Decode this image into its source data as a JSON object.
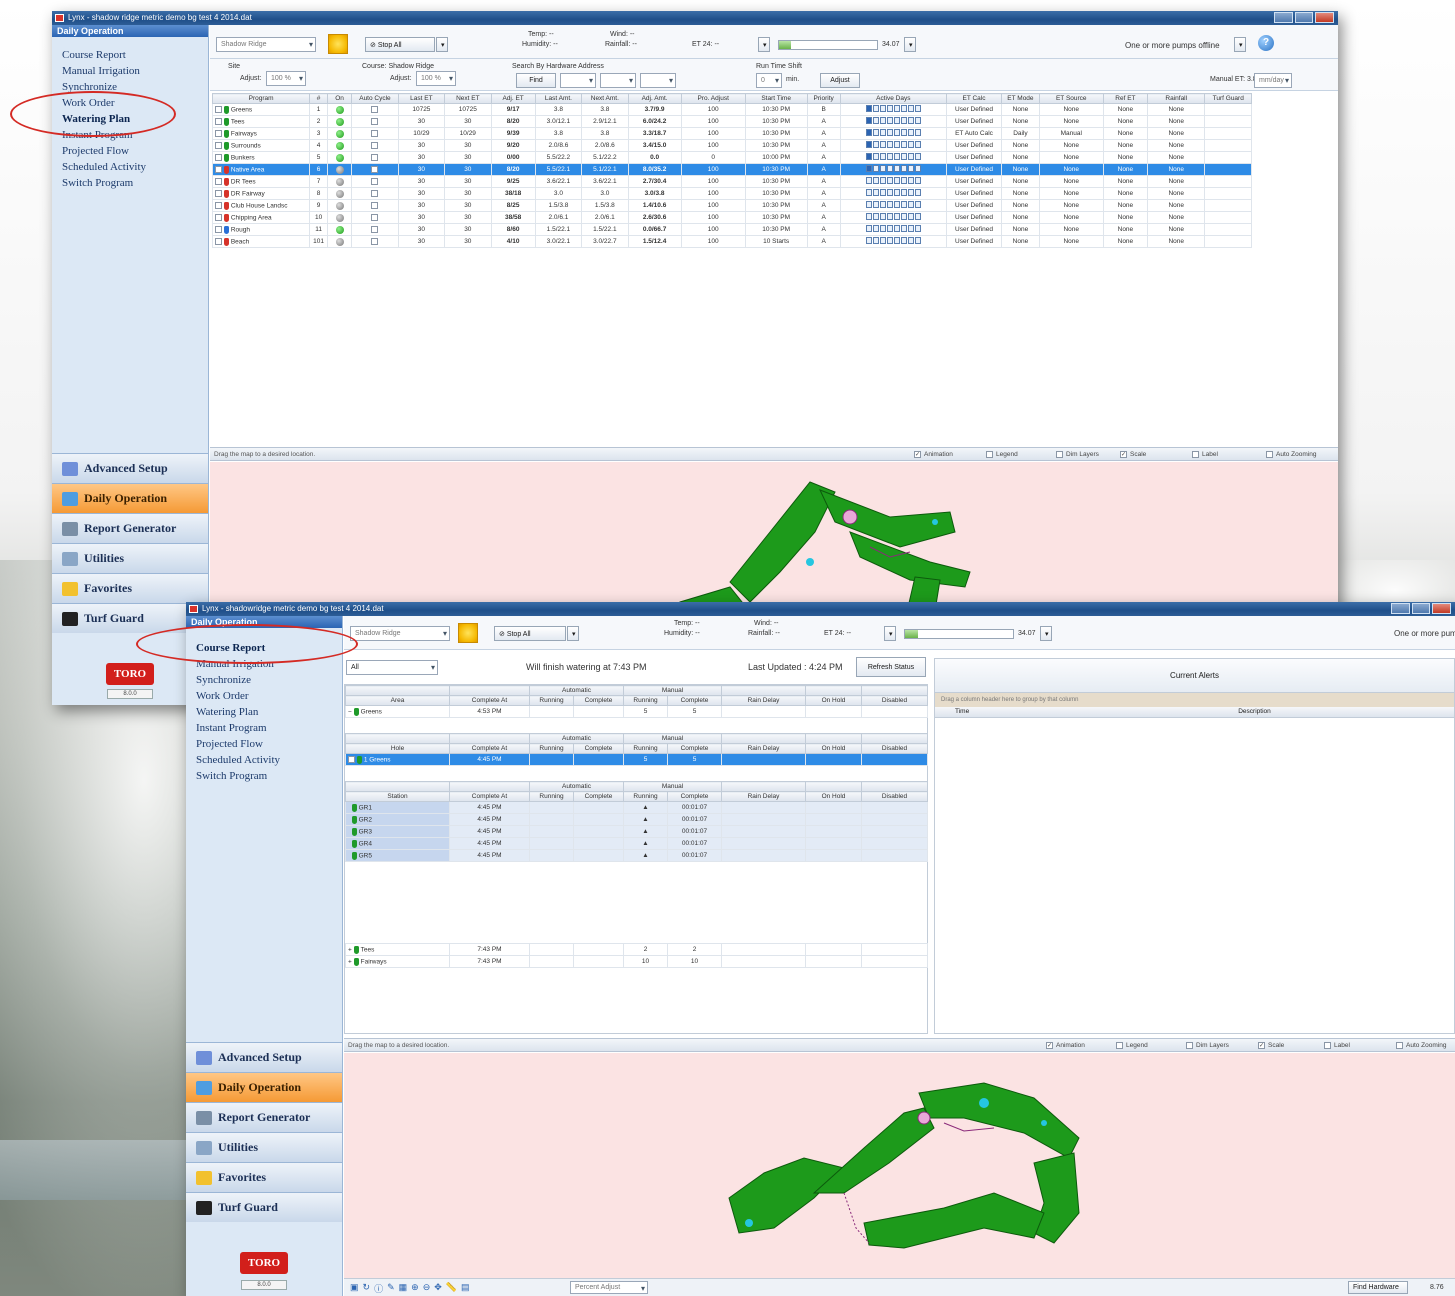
{
  "app": {
    "window1_title": "Lynx - shadow ridge metric demo bg test 4 2014.dat",
    "window2_title": "Lynx - shadowridge metric demo bg test 4 2014.dat",
    "brand": "TORO",
    "version": "8.0.0"
  },
  "nav": {
    "header": "Daily Operation",
    "items": [
      "Course Report",
      "Manual Irrigation",
      "Synchronize",
      "Work Order",
      "Watering Plan",
      "Instant Program",
      "Projected Flow",
      "Scheduled Activity",
      "Switch Program"
    ],
    "bottom": [
      "Advanced Setup",
      "Daily Operation",
      "Report Generator",
      "Utilities",
      "Favorites",
      "Turf Guard"
    ]
  },
  "weather": {
    "site": "Shadow Ridge",
    "temp": "Temp: --",
    "wind": "Wind: --",
    "humidity": "Humidity: --",
    "rainfall": "Rainfall: --",
    "et": "ET 24: --",
    "stop_all": "Stop All",
    "flow": "34.07",
    "pump_status": "One or more pumps offline"
  },
  "watering_plan": {
    "site_label": "Site",
    "adjust_label": "Adjust:",
    "adjust_value": "100 %",
    "course_label": "Course: Shadow Ridge",
    "search_label": "Search By Hardware Address",
    "find_btn": "Find",
    "run_time_label": "Run Time Shift",
    "run_time_value": "0",
    "min_label": "min.",
    "apply_btn": "Adjust",
    "manual_et": "Manual ET: 3.84",
    "mm_day": "mm/day",
    "columns": [
      "Program",
      "#",
      "On",
      "Auto Cycle",
      "Last ET",
      "Next ET",
      "Adj. ET",
      "Last Amt.",
      "Next Amt.",
      "Adj. Amt.",
      "Pro. Adjust",
      "Start Time",
      "Priority",
      "Active Days",
      "ET Calc",
      "ET Mode",
      "ET Source",
      "Ref ET",
      "Rainfall",
      "Turf Guard"
    ],
    "rows": [
      {
        "name": "Greens",
        "num": "1",
        "on": "g",
        "pin": "g",
        "last_et": "10725",
        "next_et": "10725",
        "adj_et": "9/17",
        "last_amt": "3.8",
        "next_amt": "3.8",
        "adj_amt": "3.7/9.9",
        "pro": "100",
        "start": "10:30 PM",
        "pri": "B",
        "etcalc": "User Defined",
        "etmode": "None",
        "etsrc": "None",
        "refet": "None",
        "rain": "None"
      },
      {
        "name": "Tees",
        "num": "2",
        "on": "g",
        "pin": "g",
        "last_et": "30",
        "next_et": "30",
        "adj_et": "8/20",
        "last_amt": "3.0/12.1",
        "next_amt": "2.9/12.1",
        "adj_amt": "6.0/24.2",
        "pro": "100",
        "start": "10:30 PM",
        "pri": "A",
        "etcalc": "User Defined",
        "etmode": "None",
        "etsrc": "None",
        "refet": "None",
        "rain": "None"
      },
      {
        "name": "Fairways",
        "num": "3",
        "on": "g",
        "pin": "g",
        "last_et": "10/29",
        "next_et": "10/29",
        "adj_et": "9/39",
        "last_amt": "3.8",
        "next_amt": "3.8",
        "adj_amt": "3.3/18.7",
        "pro": "100",
        "start": "10:30 PM",
        "pri": "A",
        "etcalc": "ET Auto Calc",
        "etmode": "Daily",
        "etsrc": "Manual",
        "refet": "None",
        "rain": "None"
      },
      {
        "name": "Surrounds",
        "num": "4",
        "on": "g",
        "pin": "g",
        "last_et": "30",
        "next_et": "30",
        "adj_et": "9/20",
        "last_amt": "2.0/8.6",
        "next_amt": "2.0/8.6",
        "adj_amt": "3.4/15.0",
        "pro": "100",
        "start": "10:30 PM",
        "pri": "A",
        "etcalc": "User Defined",
        "etmode": "None",
        "etsrc": "None",
        "refet": "None",
        "rain": "None"
      },
      {
        "name": "Bunkers",
        "num": "5",
        "on": "g",
        "pin": "g",
        "last_et": "30",
        "next_et": "30",
        "adj_et": "0/00",
        "last_amt": "5.5/22.2",
        "next_amt": "5.1/22.2",
        "adj_amt": "0.0",
        "pro": "0",
        "start": "10:00 PM",
        "pri": "A",
        "etcalc": "User Defined",
        "etmode": "None",
        "etsrc": "None",
        "refet": "None",
        "rain": "None"
      },
      {
        "name": "Native Area",
        "num": "6",
        "on": "gr",
        "pin": "r",
        "last_et": "30",
        "next_et": "30",
        "adj_et": "8/20",
        "last_amt": "5.5/22.1",
        "next_amt": "5.1/22.1",
        "adj_amt": "8.0/35.2",
        "pro": "100",
        "start": "10:30 PM",
        "pri": "A",
        "etcalc": "User Defined",
        "etmode": "None",
        "etsrc": "None",
        "refet": "None",
        "rain": "None",
        "selected": true
      },
      {
        "name": "DR Tees",
        "num": "7",
        "on": "gr",
        "pin": "r",
        "last_et": "30",
        "next_et": "30",
        "adj_et": "9/25",
        "last_amt": "3.6/22.1",
        "next_amt": "3.6/22.1",
        "adj_amt": "2.7/30.4",
        "pro": "100",
        "start": "10:30 PM",
        "pri": "A",
        "etcalc": "User Defined",
        "etmode": "None",
        "etsrc": "None",
        "refet": "None",
        "rain": "None"
      },
      {
        "name": "DR Fairway",
        "num": "8",
        "on": "gr",
        "pin": "r",
        "last_et": "30",
        "next_et": "30",
        "adj_et": "38/18",
        "last_amt": "3.0",
        "next_amt": "3.0",
        "adj_amt": "3.0/3.8",
        "pro": "100",
        "start": "10:30 PM",
        "pri": "A",
        "etcalc": "User Defined",
        "etmode": "None",
        "etsrc": "None",
        "refet": "None",
        "rain": "None"
      },
      {
        "name": "Club House Landsc",
        "num": "9",
        "on": "gr",
        "pin": "r",
        "last_et": "30",
        "next_et": "30",
        "adj_et": "8/25",
        "last_amt": "1.5/3.8",
        "next_amt": "1.5/3.8",
        "adj_amt": "1.4/10.6",
        "pro": "100",
        "start": "10:30 PM",
        "pri": "A",
        "etcalc": "User Defined",
        "etmode": "None",
        "etsrc": "None",
        "refet": "None",
        "rain": "None"
      },
      {
        "name": "Chipping Area",
        "num": "10",
        "on": "gr",
        "pin": "r",
        "last_et": "30",
        "next_et": "30",
        "adj_et": "38/58",
        "last_amt": "2.0/6.1",
        "next_amt": "2.0/6.1",
        "adj_amt": "2.6/30.6",
        "pro": "100",
        "start": "10:30 PM",
        "pri": "A",
        "etcalc": "User Defined",
        "etmode": "None",
        "etsrc": "None",
        "refet": "None",
        "rain": "None"
      },
      {
        "name": "Rough",
        "num": "11",
        "on": "g",
        "pin": "b",
        "last_et": "30",
        "next_et": "30",
        "adj_et": "8/60",
        "last_amt": "1.5/22.1",
        "next_amt": "1.5/22.1",
        "adj_amt": "0.0/66.7",
        "pro": "100",
        "start": "10:30 PM",
        "pri": "A",
        "etcalc": "User Defined",
        "etmode": "None",
        "etsrc": "None",
        "refet": "None",
        "rain": "None"
      },
      {
        "name": "Beach",
        "num": "101",
        "on": "gr",
        "pin": "r",
        "last_et": "30",
        "next_et": "30",
        "adj_et": "4/10",
        "last_amt": "3.0/22.1",
        "next_amt": "3.0/22.7",
        "adj_amt": "1.5/12.4",
        "pro": "100",
        "start": "10 Starts",
        "pri": "A",
        "etcalc": "User Defined",
        "etmode": "None",
        "etsrc": "None",
        "refet": "None",
        "rain": "None"
      }
    ]
  },
  "map": {
    "hint": "Drag the map to a desired location.",
    "options": [
      "Animation",
      "Legend",
      "Dim Layers",
      "Scale",
      "Label",
      "Auto Zooming"
    ]
  },
  "course_report": {
    "filter": "All",
    "finish_text": "Will finish watering at 7:43 PM",
    "last_updated": "Last Updated : 4:24 PM",
    "refresh_btn": "Refresh Status",
    "alerts_title": "Current Alerts",
    "alerts_group_hint": "Drag a column header here to group by that column",
    "alerts_cols": [
      "Time",
      "Description"
    ],
    "group_auto": "Automatic",
    "group_manual": "Manual",
    "area_cols": [
      "Area",
      "Complete At",
      "Running",
      "Complete",
      "Running",
      "Complete",
      "Rain Delay",
      "On Hold",
      "Disabled"
    ],
    "hole_cols": [
      "Hole",
      "Complete At",
      "Running",
      "Complete",
      "Running",
      "Complete",
      "Rain Delay",
      "On Hold",
      "Disabled"
    ],
    "station_cols": [
      "Station",
      "Complete At",
      "Running",
      "Complete",
      "Running",
      "Complete",
      "Rain Delay",
      "On Hold",
      "Disabled"
    ],
    "greens": {
      "name": "Greens",
      "complete": "4:53 PM",
      "mrun": "5",
      "mcomp": "5"
    },
    "holes": [
      {
        "name": "1 Greens",
        "complete": "4:45 PM",
        "mrun": "5",
        "mcomp": "5"
      }
    ],
    "stations": [
      {
        "name": "GR1",
        "complete": "4:45 PM",
        "mcomp": "00:01:07"
      },
      {
        "name": "GR2",
        "complete": "4:45 PM",
        "mcomp": "00:01:07"
      },
      {
        "name": "GR3",
        "complete": "4:45 PM",
        "mcomp": "00:01:07"
      },
      {
        "name": "GR4",
        "complete": "4:45 PM",
        "mcomp": "00:01:07"
      },
      {
        "name": "GR5",
        "complete": "4:45 PM",
        "mcomp": "00:01:07"
      }
    ],
    "other_areas": [
      {
        "name": "Tees",
        "complete": "7:43 PM",
        "mrun": "2",
        "mcomp": "2"
      },
      {
        "name": "Fairways",
        "complete": "7:43 PM",
        "mrun": "10",
        "mcomp": "10"
      }
    ],
    "percent_adjust": "Percent Adjust",
    "find_hardware": "Find Hardware",
    "coords": "8.76"
  },
  "colors": {
    "nav_bg": "#dce8f5",
    "accent": "#2e8be6",
    "selected_nav": "#f59a35",
    "map_bg": "#fbe3e3",
    "course_green": "#1d9a1b",
    "highlight_oval": "#d42a24"
  }
}
